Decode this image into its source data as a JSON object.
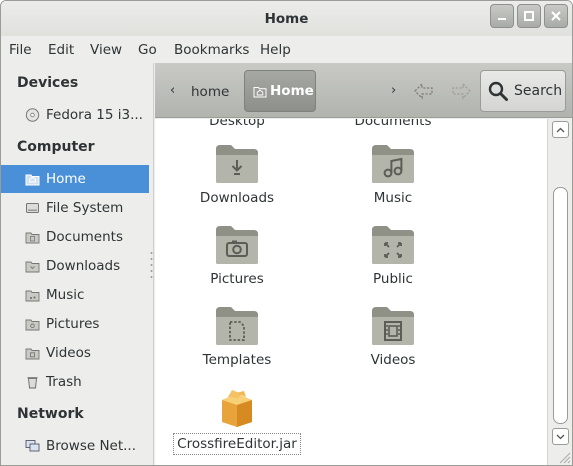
{
  "window": {
    "title": "Home",
    "controls": {
      "minimize": "—",
      "maximize": "▢",
      "close": "✕"
    }
  },
  "menubar": [
    "File",
    "Edit",
    "View",
    "Go",
    "Bookmarks",
    "Help"
  ],
  "sidebar": {
    "devices_heading": "Devices",
    "devices": [
      {
        "label": "Fedora 15 i3...",
        "icon": "disc-icon"
      }
    ],
    "computer_heading": "Computer",
    "computer": [
      {
        "label": "Home",
        "icon": "home-folder-icon",
        "active": true
      },
      {
        "label": "File System",
        "icon": "drive-icon"
      },
      {
        "label": "Documents",
        "icon": "documents-folder-icon"
      },
      {
        "label": "Downloads",
        "icon": "downloads-folder-icon"
      },
      {
        "label": "Music",
        "icon": "music-folder-icon"
      },
      {
        "label": "Pictures",
        "icon": "pictures-folder-icon"
      },
      {
        "label": "Videos",
        "icon": "videos-folder-icon"
      },
      {
        "label": "Trash",
        "icon": "trash-icon"
      }
    ],
    "network_heading": "Network",
    "network": [
      {
        "label": "Browse Net...",
        "icon": "network-icon"
      }
    ]
  },
  "toolbar": {
    "left_arrow": "‹",
    "right_arrow": "›",
    "crumb_parent": "home",
    "crumb_current": "Home",
    "search_label": "Search"
  },
  "files": [
    {
      "name": "Desktop",
      "icon": "desktop-folder-icon"
    },
    {
      "name": "Documents",
      "icon": "documents-folder-icon"
    },
    {
      "name": "Downloads",
      "icon": "downloads-folder-icon"
    },
    {
      "name": "Music",
      "icon": "music-folder-icon"
    },
    {
      "name": "Pictures",
      "icon": "pictures-folder-icon"
    },
    {
      "name": "Public",
      "icon": "public-folder-icon"
    },
    {
      "name": "Templates",
      "icon": "templates-folder-icon"
    },
    {
      "name": "Videos",
      "icon": "videos-folder-icon"
    },
    {
      "name": "CrossfireEditor.jar",
      "icon": "jar-package-icon",
      "selected": true
    }
  ],
  "colors": {
    "selection": "#4a90d9",
    "folder": "#9c9d92"
  }
}
